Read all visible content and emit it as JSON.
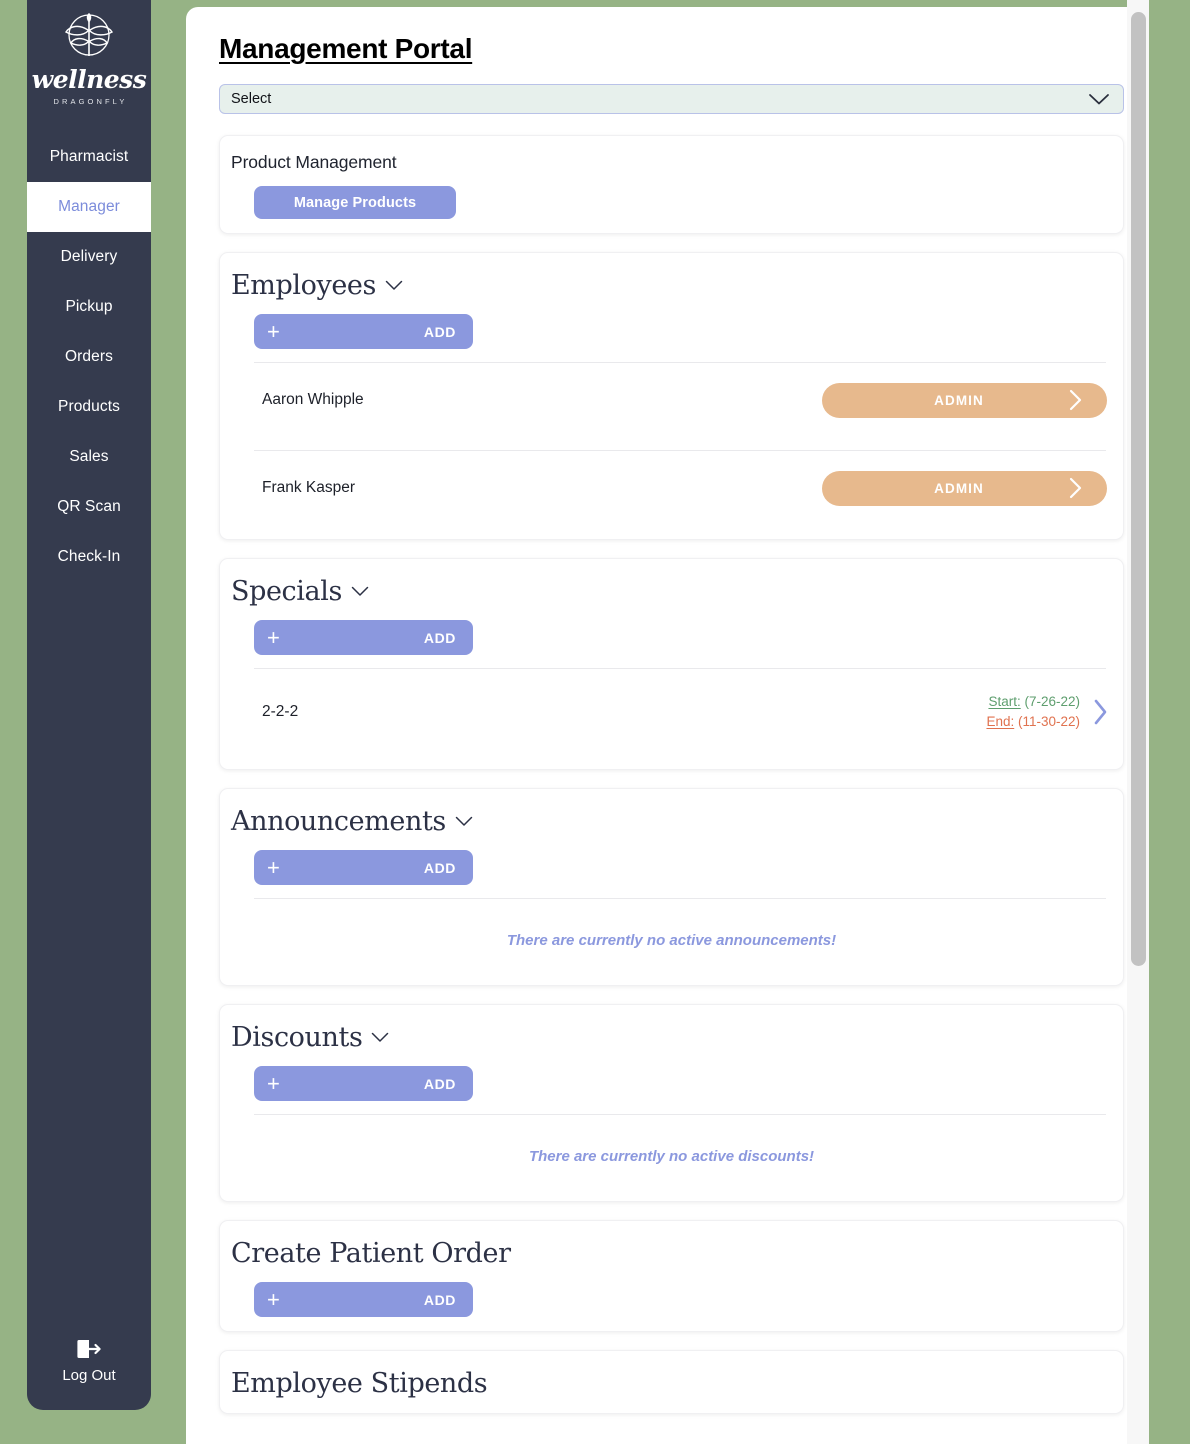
{
  "theme": {
    "page_background": "#96b385",
    "sidebar_background": "#353b4e",
    "accent_periwinkle": "#8b98de",
    "accent_tan": "#e7b98d",
    "date_start_color": "#5e9e6e",
    "date_end_color": "#e0724f"
  },
  "sidebar": {
    "logo": {
      "wordmark": "wellness",
      "sub": "DRAGONFLY",
      "icon": "dragonfly-plant-logo-icon"
    },
    "items": [
      {
        "label": "Pharmacist",
        "active": false
      },
      {
        "label": "Manager",
        "active": true
      },
      {
        "label": "Delivery",
        "active": false
      },
      {
        "label": "Pickup",
        "active": false
      },
      {
        "label": "Orders",
        "active": false
      },
      {
        "label": "Products",
        "active": false
      },
      {
        "label": "Sales",
        "active": false
      },
      {
        "label": "QR Scan",
        "active": false
      },
      {
        "label": "Check-In",
        "active": false
      }
    ],
    "logout": {
      "label": "Log Out",
      "icon": "logout-icon"
    }
  },
  "header": {
    "title": "Management Portal"
  },
  "select": {
    "value": "Select",
    "icon": "chevron-down-icon"
  },
  "product_management": {
    "title": "Product Management",
    "manage_button": "Manage Products"
  },
  "employees": {
    "title": "Employees",
    "chevron": "chevron-down-icon",
    "add_button": {
      "plus": "+",
      "label": "ADD"
    },
    "rows": [
      {
        "name": "Aaron Whipple",
        "role": "ADMIN",
        "arrow": "chevron-right-icon"
      },
      {
        "name": "Frank Kasper",
        "role": "ADMIN",
        "arrow": "chevron-right-icon"
      }
    ]
  },
  "specials": {
    "title": "Specials",
    "chevron": "chevron-down-icon",
    "add_button": {
      "plus": "+",
      "label": "ADD"
    },
    "rows": [
      {
        "name": "2-2-2",
        "start_key": "Start:",
        "start_value": " (7-26-22)",
        "end_key": "End:",
        "end_value": " (11-30-22)",
        "arrow": "chevron-right-icon"
      }
    ]
  },
  "announcements": {
    "title": "Announcements",
    "chevron": "chevron-down-icon",
    "add_button": {
      "plus": "+",
      "label": "ADD"
    },
    "empty_message": "There are currently no active announcements!"
  },
  "discounts": {
    "title": "Discounts",
    "chevron": "chevron-down-icon",
    "add_button": {
      "plus": "+",
      "label": "ADD"
    },
    "empty_message": "There are currently no active discounts!"
  },
  "create_patient_order": {
    "title": "Create Patient Order",
    "add_button": {
      "plus": "+",
      "label": "ADD"
    }
  },
  "employee_stipends": {
    "title": "Employee Stipends"
  }
}
